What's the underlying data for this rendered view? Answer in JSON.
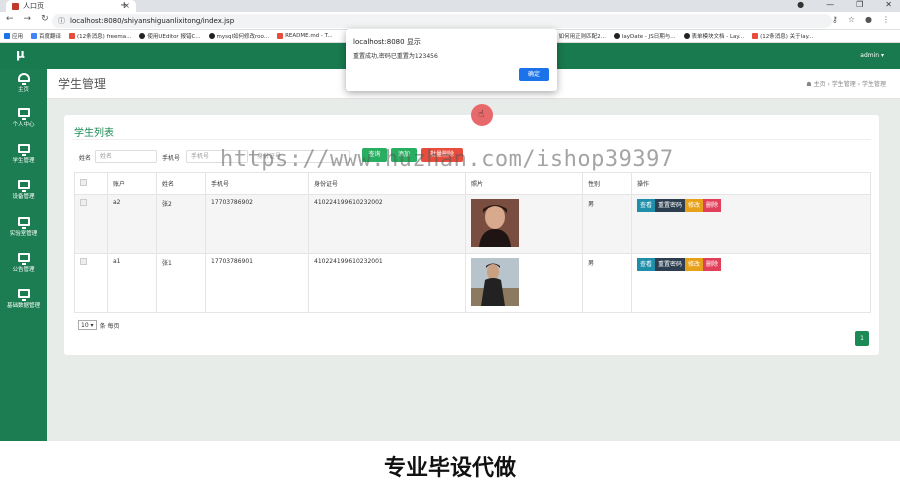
{
  "browser": {
    "tab_title": "人口页",
    "url": "localhost:8080/shiyanshiguanlixitong/index.jsp",
    "win_controls": [
      "●",
      "—",
      "❐",
      "✕"
    ],
    "bookmarks": [
      "应用",
      "百度翻译",
      "(12条消息) freema...",
      "使用UEditor 报错C...",
      "mysql如何修改roo...",
      "README.md - T...",
      "如何用正则匹配2...",
      "layDate - JS日期与...",
      "表单模块文档 - Lay...",
      "(12条消息) 关于lay..."
    ]
  },
  "header": {
    "brand": "μ",
    "user": "admin ▾"
  },
  "sidebar": {
    "items": [
      {
        "label": "主页"
      },
      {
        "label": "个人中心"
      },
      {
        "label": "学生管理"
      },
      {
        "label": "设备管理"
      },
      {
        "label": "实验室管理"
      },
      {
        "label": "公告管理"
      },
      {
        "label": "基础数据管理"
      }
    ]
  },
  "page": {
    "title": "学生管理",
    "breadcrumb": "☗ 主页  ›  学生管理  ›  学生管理"
  },
  "card": {
    "title": "学生列表",
    "search": {
      "name_label": "姓名",
      "name_placeholder": "姓名",
      "phone_label": "手机号",
      "phone_placeholder": "手机号",
      "id_placeholder": "身份证号"
    },
    "buttons": {
      "search": "查询",
      "add": "添加",
      "batch_delete": "批量删除"
    },
    "table": {
      "headers": [
        "账户",
        "姓名",
        "手机号",
        "身份证号",
        "照片",
        "性别",
        "操作"
      ],
      "rows": [
        {
          "account": "a2",
          "name": "张2",
          "phone": "17703786902",
          "id_card": "410224199610232002",
          "gender": "男"
        },
        {
          "account": "a1",
          "name": "张1",
          "phone": "17703786901",
          "id_card": "410224199610232001",
          "gender": "男"
        }
      ],
      "actions": {
        "view": "查看",
        "reset": "重置密码",
        "edit": "修改",
        "delete": "删除"
      }
    },
    "pager": {
      "page_size": "10 ▾",
      "suffix": "条 每页",
      "current_page": "1"
    }
  },
  "dialog": {
    "title": "localhost:8080 显示",
    "message": "重置成功,密码已重置为123456",
    "ok": "确定"
  },
  "watermark": "https://www.huzhan.com/ishop39397",
  "promo": "专业毕设代做",
  "colors": {
    "header": "#1a7a4f",
    "sidebar": "#1b7d51",
    "accent": "#1b8a55"
  }
}
